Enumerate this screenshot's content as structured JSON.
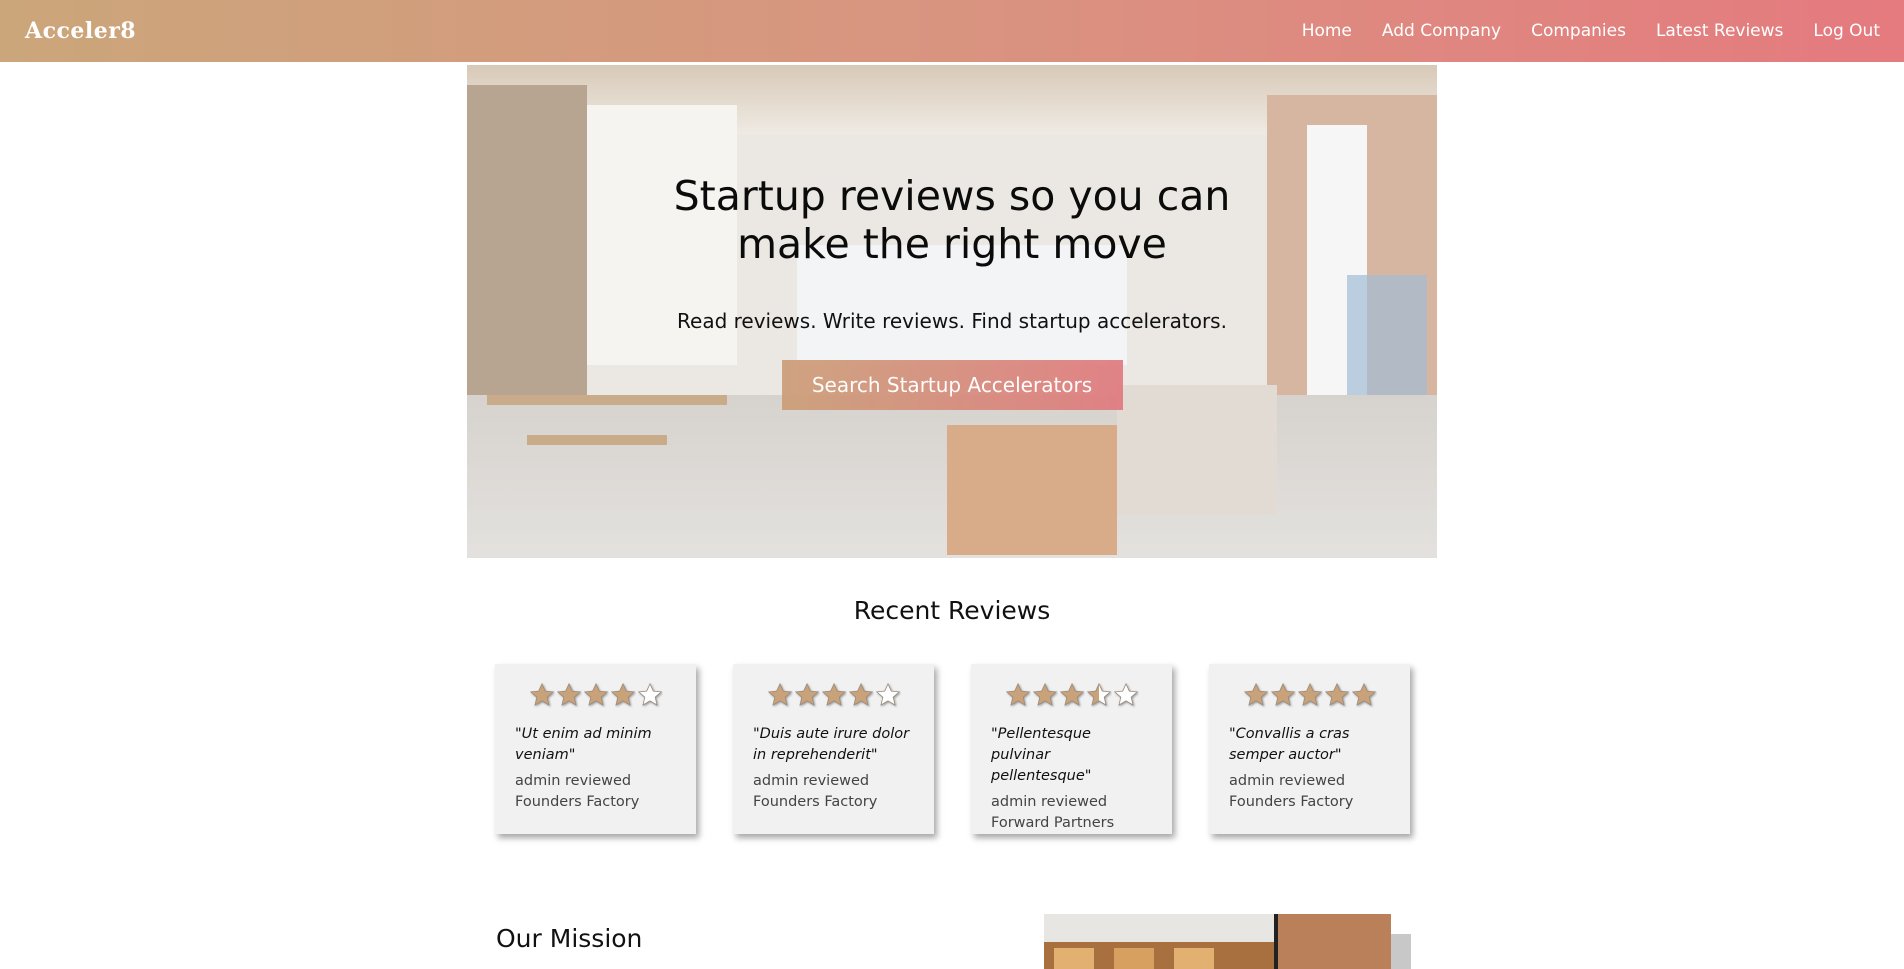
{
  "navbar": {
    "brand": "Acceler8",
    "links": [
      "Home",
      "Add Company",
      "Companies",
      "Latest Reviews",
      "Log Out"
    ]
  },
  "hero": {
    "title": "Startup reviews so you can make the right move",
    "subtitle": "Read reviews. Write reviews. Find startup accelerators.",
    "button_label": "Search Startup Accelerators"
  },
  "recent_reviews": {
    "title": "Recent Reviews",
    "items": [
      {
        "rating": 4,
        "quote": "\"Ut enim ad minim veniam\"",
        "author_line": "admin reviewed",
        "company": "Founders Factory"
      },
      {
        "rating": 4,
        "quote": "\"Duis aute irure dolor in reprehenderit\"",
        "author_line": "admin reviewed",
        "company": "Founders Factory"
      },
      {
        "rating": 3.5,
        "quote": "\"Pellentesque pulvinar pellentesque\"",
        "author_line": "admin reviewed",
        "company": "Forward Partners"
      },
      {
        "rating": 5,
        "quote": "\"Convallis a cras semper auctor\"",
        "author_line": "admin reviewed",
        "company": "Founders Factory"
      }
    ]
  },
  "mission": {
    "title": "Our Mission"
  },
  "colors": {
    "gradient_start": "#cba67a",
    "gradient_end": "#e57a7f",
    "star_fill": "#c9a27a",
    "star_empty": "#ffffff"
  }
}
